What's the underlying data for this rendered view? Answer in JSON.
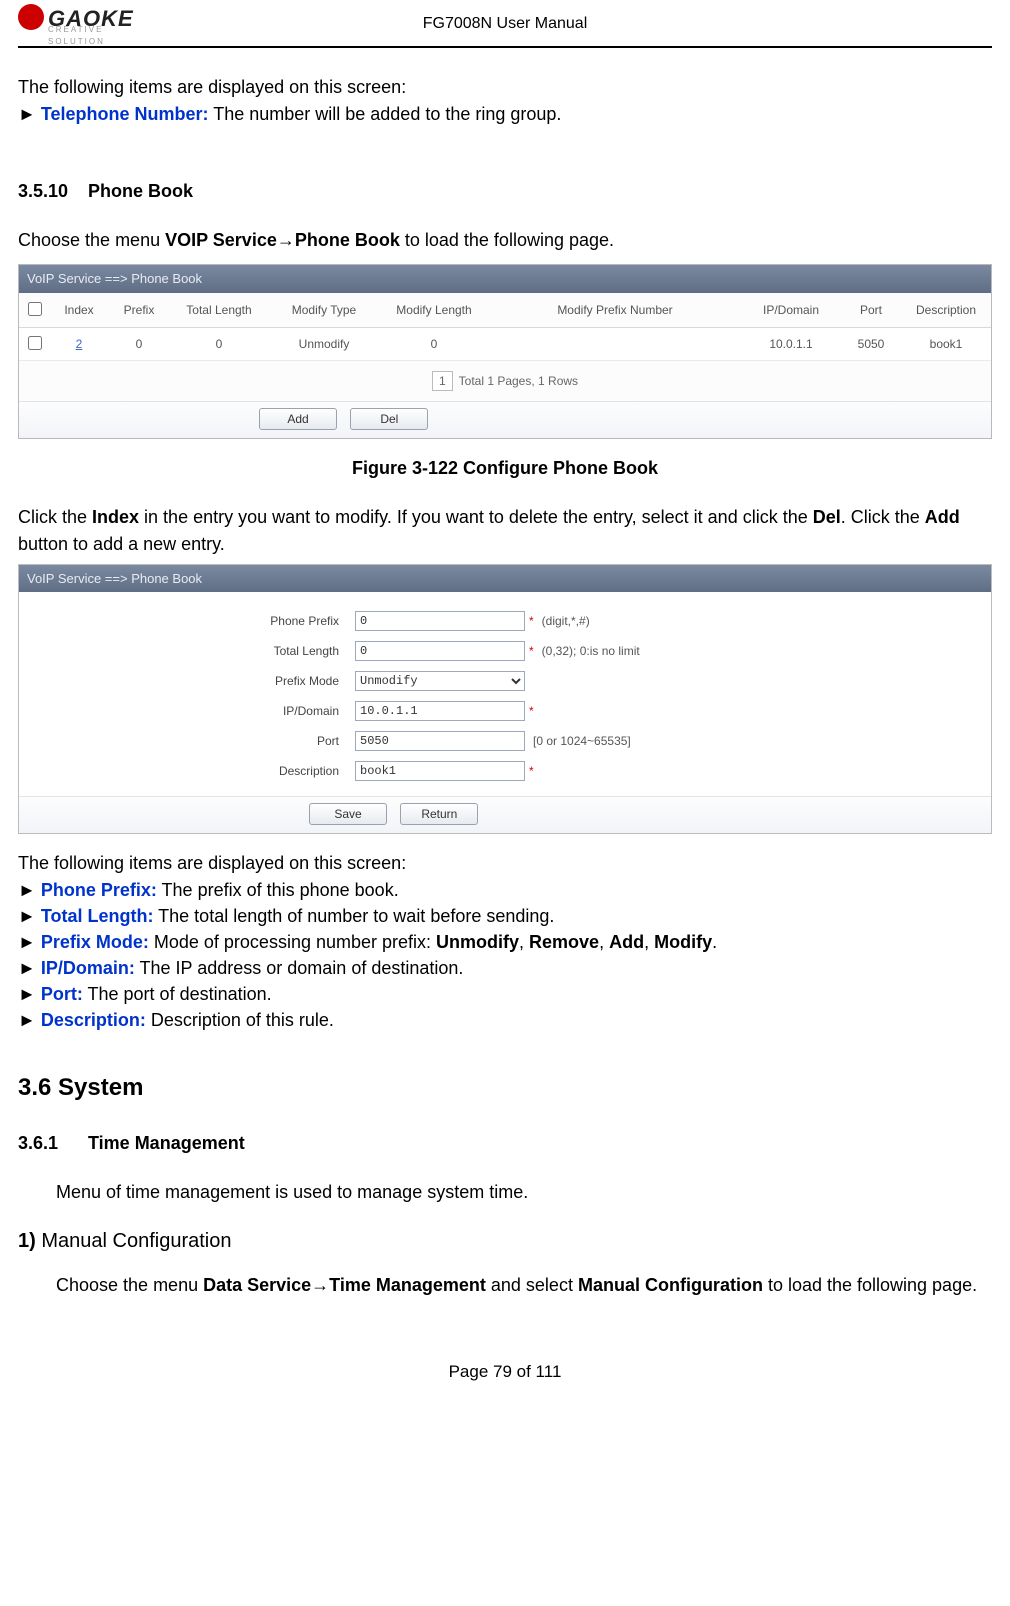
{
  "header": {
    "logo_text": "GAOKE",
    "logo_sub": "CREATIVE SOLUTION",
    "title": "FG7008N User Manual"
  },
  "intro_line": "The following items are displayed on this screen:",
  "tel_number": {
    "label": "Telephone Number:",
    "desc": " The number will be added to the ring group."
  },
  "sec_3_5_10": {
    "num": "3.5.10",
    "title": "Phone Book",
    "menu_line_pre": "Choose the menu ",
    "menu_bold_1": "VOIP Service",
    "arrow": "→",
    "menu_bold_2": "Phone Book",
    "menu_line_post": " to load the following page."
  },
  "table_panel": {
    "title": "VoIP Service ==> Phone Book",
    "headers": [
      "",
      "Index",
      "Prefix",
      "Total Length",
      "Modify Type",
      "Modify Length",
      "Modify Prefix Number",
      "IP/Domain",
      "Port",
      "Description"
    ],
    "row": {
      "index": "2",
      "prefix": "0",
      "total_length": "0",
      "modify_type": "Unmodify",
      "modify_length": "0",
      "modify_prefix_number": "",
      "ip_domain": "10.0.1.1",
      "port": "5050",
      "description": "book1"
    },
    "pager_num": "1",
    "pager_text": "Total 1 Pages, 1 Rows",
    "btn_add": "Add",
    "btn_del": "Del"
  },
  "figure_caption": "Figure 3-122 Configure Phone Book",
  "click_line": {
    "t1": "Click the ",
    "b1": "Index",
    "t2": " in the entry you want to modify. If you want to delete the entry, select it and click the ",
    "b2": "Del",
    "t3": ". Click the ",
    "b3": "Add",
    "t4": " button to add a new entry."
  },
  "form_panel": {
    "title": "VoIP Service ==> Phone Book",
    "rows": {
      "phone_prefix": {
        "label": "Phone Prefix",
        "value": "0",
        "hint": "(digit,*,#)"
      },
      "total_length": {
        "label": "Total Length",
        "value": "0",
        "hint": "(0,32); 0:is no limit"
      },
      "prefix_mode": {
        "label": "Prefix Mode",
        "value": "Unmodify"
      },
      "ip_domain": {
        "label": "IP/Domain",
        "value": "10.0.1.1"
      },
      "port": {
        "label": "Port",
        "value": "5050",
        "hint": "[0 or 1024~65535]"
      },
      "description": {
        "label": "Description",
        "value": "book1"
      }
    },
    "btn_save": "Save",
    "btn_return": "Return"
  },
  "items_intro": "The following items are displayed on this screen:",
  "items": {
    "phone_prefix": {
      "label": "Phone Prefix:",
      "desc": " The prefix of this phone book."
    },
    "total_length": {
      "label": "Total Length:",
      "desc": " The total length of number to wait before sending."
    },
    "prefix_mode": {
      "label": "Prefix Mode:",
      "desc_pre": "   Mode of processing number prefix: ",
      "b1": "Unmodify",
      "b2": "Remove",
      "b3": "Add",
      "b4": "Modify"
    },
    "ip_domain": {
      "label": "IP/Domain:",
      "desc": "     The IP address or domain of destination."
    },
    "port": {
      "label": "Port:",
      "desc": "             The port of destination."
    },
    "description": {
      "label": "Description:",
      "desc": "   Description of this rule."
    }
  },
  "sec_3_6": {
    "num_title": "3.6 System"
  },
  "sec_3_6_1": {
    "num": "3.6.1",
    "title": "Time Management",
    "line": "Menu of time management is used to manage system time."
  },
  "sub_1": {
    "head": "1) Manual Configuration",
    "t1": "Choose the menu ",
    "b1": "Data Service",
    "arrow": "→",
    "b2": "Time Management",
    "t2": " and select ",
    "b3": "Manual Configuration",
    "t3": " to load the following page."
  },
  "footer": "Page 79 of 111"
}
